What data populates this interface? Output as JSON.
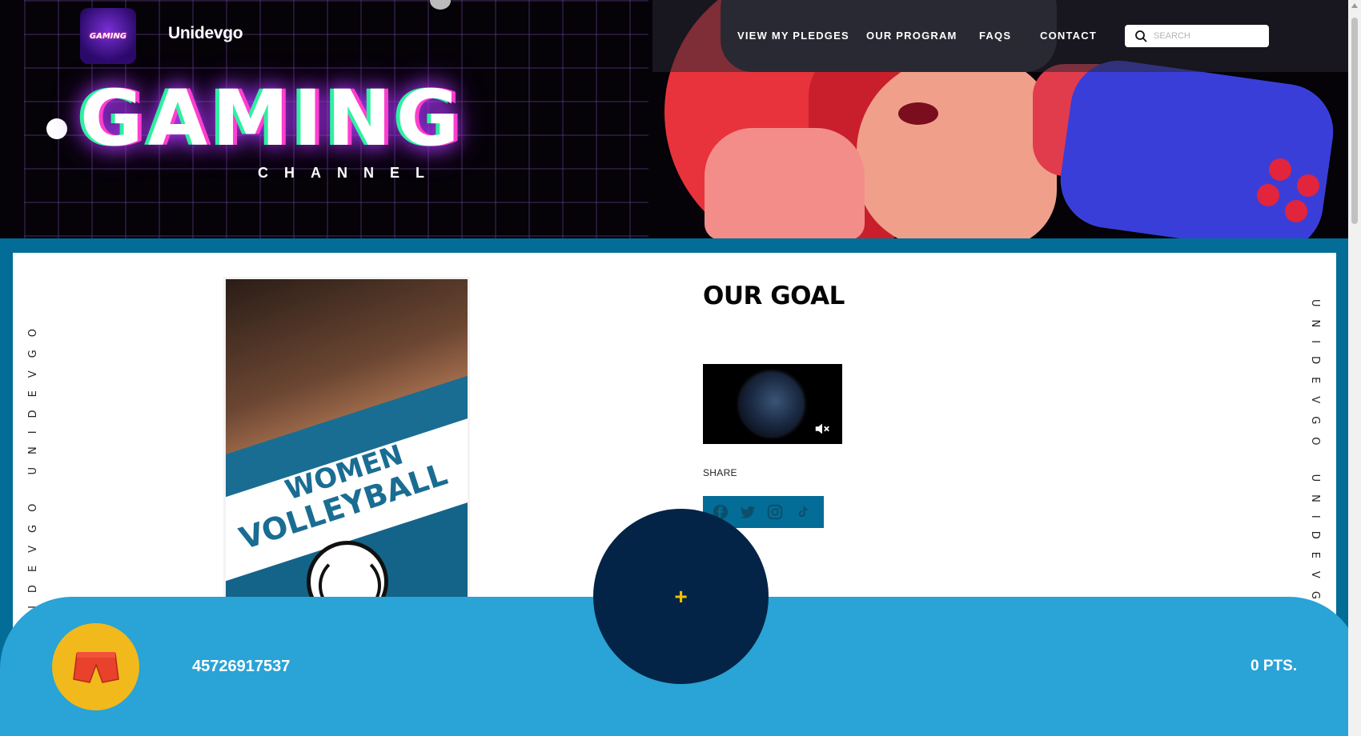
{
  "header": {
    "brand": "Unidevgo",
    "logo_text": "GAMING",
    "nav": [
      {
        "label": "VIEW MY PLEDGES"
      },
      {
        "label": "OUR PROGRAM"
      },
      {
        "label": "FAQS"
      },
      {
        "label": "CONTACT"
      }
    ],
    "search": {
      "placeholder": "SEARCH",
      "value": ""
    },
    "banner_title": "GAMING",
    "banner_subtitle": "CHANNEL"
  },
  "side": {
    "left_text": "UNIDEVGO UNIDEVGO",
    "right_text": "UNIDEVGO UNIDEVGO"
  },
  "poster": {
    "line1": "WOMEN",
    "line2": "VOLLEYBALL"
  },
  "goal": {
    "title": "OUR GOAL",
    "share_label": "SHARE",
    "share_icons": [
      "facebook-icon",
      "twitter-icon",
      "instagram-icon",
      "tiktok-icon"
    ]
  },
  "bottom": {
    "fab_label": "+",
    "account_number": "45726917537",
    "points": "0 PTS."
  },
  "colors": {
    "frame_blue": "#036d97",
    "bar_blue": "#2aa3d6",
    "fab_navy": "#032446",
    "avatar_yellow": "#f1b91b",
    "plus_yellow": "#f2c000"
  }
}
